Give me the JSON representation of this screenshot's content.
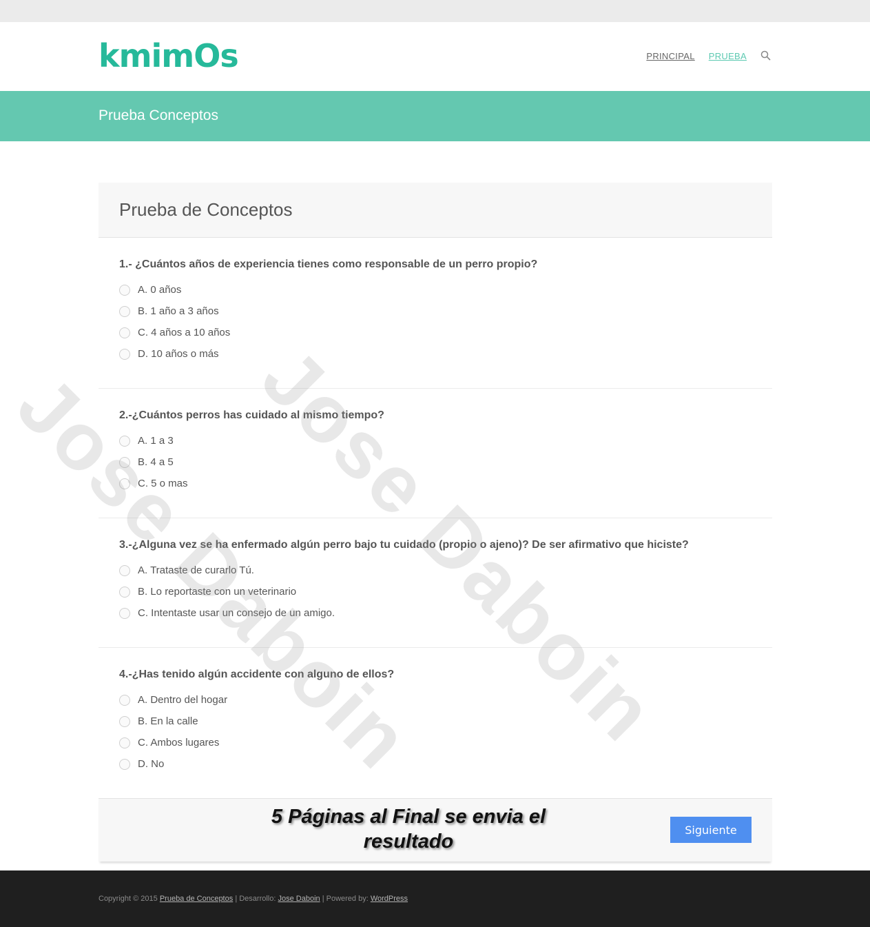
{
  "header": {
    "logo_text": "kmimOs",
    "nav": [
      {
        "label": "PRINCIPAL",
        "active": false
      },
      {
        "label": "PRUEBA",
        "active": true
      }
    ],
    "search_icon": "search-icon"
  },
  "banner": {
    "title": "Prueba Conceptos"
  },
  "card": {
    "title": "Prueba de Conceptos",
    "questions": [
      {
        "text": "1.- ¿Cuántos años de experiencia tienes como responsable de un perro propio?",
        "options": [
          "A. 0 años",
          "B. 1 año a 3 años",
          "C. 4 años a 10 años",
          "D. 10 años o más"
        ]
      },
      {
        "text": "2.-¿Cuántos perros has cuidado al mismo tiempo?",
        "options": [
          "A. 1 a 3",
          "B. 4 a 5",
          "C. 5 o mas"
        ]
      },
      {
        "text": "3.-¿Alguna vez se ha enfermado algún perro bajo tu cuidado (propio o ajeno)? De ser afirmativo que hiciste?",
        "options": [
          "A. Trataste de curarlo Tú.",
          "B. Lo reportaste con un veterinario",
          "C. Intentaste usar un consejo de un amigo."
        ]
      },
      {
        "text": "4.-¿Has tenido algún accidente con alguno de ellos?",
        "options": [
          "A. Dentro del hogar",
          "B. En la calle",
          "C. Ambos lugares",
          "D. No"
        ]
      }
    ],
    "footer_note": "5 Páginas al Final se envia el resultado",
    "next_button": "Siguiente"
  },
  "footer": {
    "copyright": "Copyright © 2015",
    "site_link": "Prueba de Conceptos",
    "dev_label": "| Desarrollo:",
    "dev_link": "Jose Daboin",
    "powered_label": "| Powered by:",
    "powered_link": "WordPress"
  },
  "watermark": "Jose Daboin",
  "colors": {
    "accent": "#64c8b0",
    "logo": "#26b99a",
    "button": "#4f8ff0"
  }
}
